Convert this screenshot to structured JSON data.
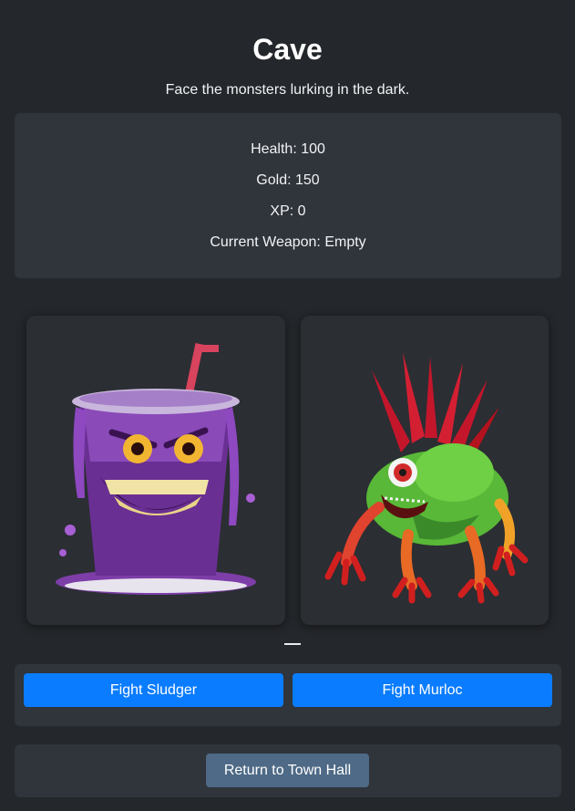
{
  "header": {
    "title": "Cave",
    "subtitle": "Face the monsters lurking in the dark."
  },
  "stats": {
    "health": "Health: 100",
    "gold": "Gold: 150",
    "xp": "XP: 0",
    "weapon": "Current Weapon: Empty"
  },
  "monsters": [
    {
      "name": "Sludger",
      "image": "purple-slime-cup-monster"
    },
    {
      "name": "Murloc",
      "image": "green-murloc-creature"
    }
  ],
  "actions": {
    "fight_sludger": "Fight Sludger",
    "fight_murloc": "Fight Murloc",
    "return_town": "Return to Town Hall"
  },
  "colors": {
    "background": "#24272b",
    "panel": "#30343b",
    "primary_button": "#0a7cff",
    "secondary_button": "#4e6a86"
  }
}
